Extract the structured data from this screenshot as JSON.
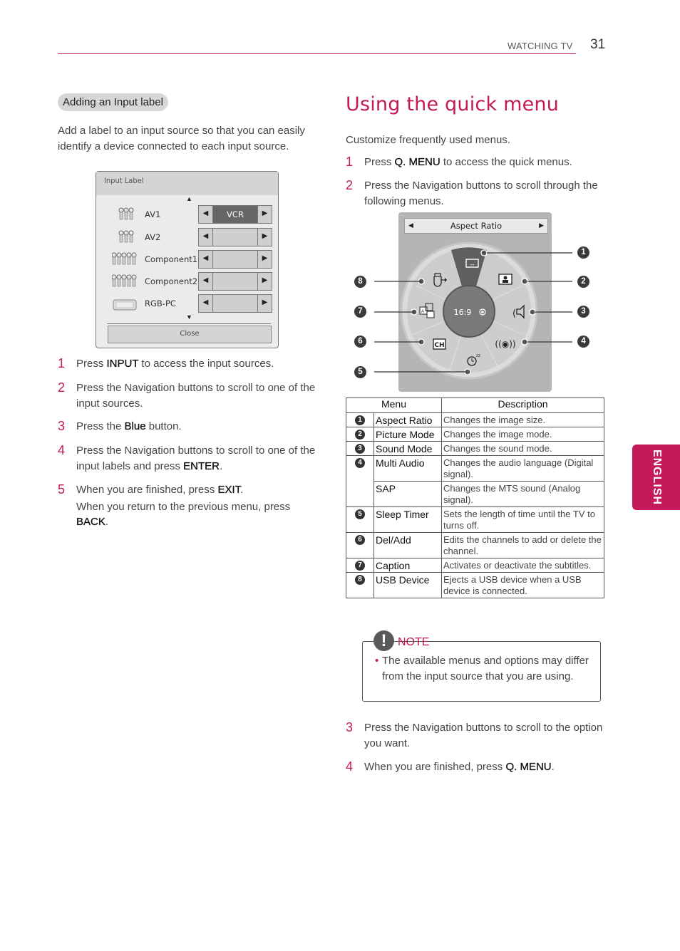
{
  "header": {
    "section": "WATCHING TV",
    "page_number": "31"
  },
  "side_tab": {
    "label": "ENGLISH",
    "color": "#c5195a"
  },
  "left": {
    "pill_title": "Adding an Input label",
    "intro": "Add a label to an input source so that you can easily identify a device connected to each input source.",
    "dialog": {
      "title": "Input Label",
      "rows": [
        {
          "icon": "av-connector-icon",
          "label": "AV1",
          "value": "VCR",
          "selected": true
        },
        {
          "icon": "av-connector-icon",
          "label": "AV2",
          "value": "",
          "selected": false
        },
        {
          "icon": "component-connector-icon",
          "label": "Component1",
          "value": "",
          "selected": false
        },
        {
          "icon": "component-connector-icon",
          "label": "Component2",
          "value": "",
          "selected": false
        },
        {
          "icon": "rgb-pc-connector-icon",
          "label": "RGB-PC",
          "value": "",
          "selected": false
        }
      ],
      "close_label": "Close"
    },
    "steps": [
      {
        "num": "1",
        "pre": "Press ",
        "key": "INPUT",
        "post": " to access the input sources."
      },
      {
        "num": "2",
        "pre": "Press the Navigation buttons to scroll to one of the input sources.",
        "key": "",
        "post": ""
      },
      {
        "num": "3",
        "pre": "Press the ",
        "key": "Blue",
        "post": " button."
      },
      {
        "num": "4",
        "pre": "Press the Navigation buttons to scroll to one of the input labels and press ",
        "key": "ENTER",
        "post": "."
      },
      {
        "num": "5",
        "pre": "When you are finished, press ",
        "key": "EXIT",
        "post": "."
      }
    ],
    "step5_extra": {
      "pre": "When you return to the previous menu, press ",
      "key": "BACK",
      "post": "."
    }
  },
  "right": {
    "title": "Using the quick menu",
    "intro": "Customize frequently used menus.",
    "steps_top": [
      {
        "num": "1",
        "pre": "Press ",
        "key": "Q. MENU",
        "post": " to access the quick menus."
      },
      {
        "num": "2",
        "pre": "Press the Navigation buttons to scroll through the following menus.",
        "key": "",
        "post": ""
      }
    ],
    "quick_menu": {
      "bar_label": "Aspect Ratio",
      "center_value": "16:9",
      "callouts": [
        "1",
        "2",
        "3",
        "4",
        "5",
        "6",
        "7",
        "8"
      ]
    },
    "table": {
      "headers": [
        "Menu",
        "Description"
      ],
      "rows": [
        {
          "num": "1",
          "menu": "Aspect Ratio",
          "desc": "Changes the image size."
        },
        {
          "num": "2",
          "menu": "Picture Mode",
          "desc": "Changes the image mode."
        },
        {
          "num": "3",
          "menu": "Sound Mode",
          "desc": "Changes the sound mode."
        },
        {
          "num": "4",
          "menu": "Multi Audio",
          "desc": "Changes the audio language (Digital signal)."
        },
        {
          "num": "",
          "menu": "SAP",
          "desc": "Changes the MTS sound (Analog signal)."
        },
        {
          "num": "5",
          "menu": "Sleep Timer",
          "desc": "Sets the length of time until the TV to turns off."
        },
        {
          "num": "6",
          "menu": "Del/Add",
          "desc": "Edits the channels to add or delete the channel."
        },
        {
          "num": "7",
          "menu": "Caption",
          "desc": "Activates or deactivate the subtitles."
        },
        {
          "num": "8",
          "menu": "USB Device",
          "desc": "Ejects a USB device when a USB device is connected."
        }
      ]
    },
    "note": {
      "title": "NOTE",
      "bullet": "The available menus and options may differ from the input source that you are using."
    },
    "steps_bottom": [
      {
        "num": "3",
        "pre": "Press the Navigation buttons to scroll to the option you want.",
        "key": "",
        "post": ""
      },
      {
        "num": "4",
        "pre": "When you are finished, press ",
        "key": "Q. MENU",
        "post": "."
      }
    ]
  }
}
